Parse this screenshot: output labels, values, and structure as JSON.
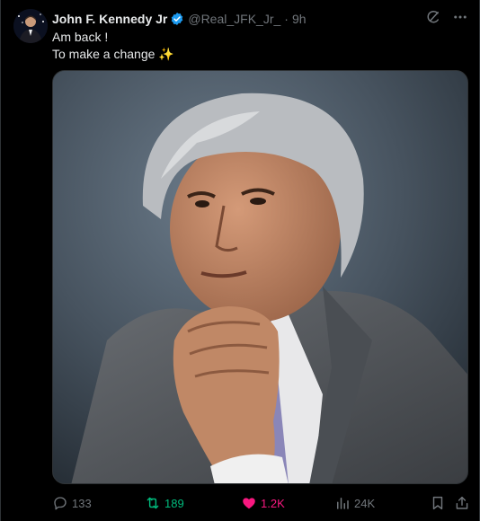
{
  "author": {
    "display_name": "John F. Kennedy Jr",
    "handle": "@Real_JFK_Jr_",
    "separator": "·",
    "time": "9h",
    "verified_color": "#1d9bf0",
    "avatar_icon": "avatar-image"
  },
  "tweet": {
    "line1": "Am back !",
    "line2": "To make a change",
    "emoji": "✨"
  },
  "media": {
    "icon": "portrait-photo-image"
  },
  "actions": {
    "reply_count": "133",
    "retweet_count": "189",
    "like_count": "1.2K",
    "views_count": "24K"
  },
  "colors": {
    "background": "#000000",
    "text": "#e7e9ea",
    "muted": "#71767b",
    "retweet_active": "#00ba7c",
    "like_active": "#f91880"
  }
}
